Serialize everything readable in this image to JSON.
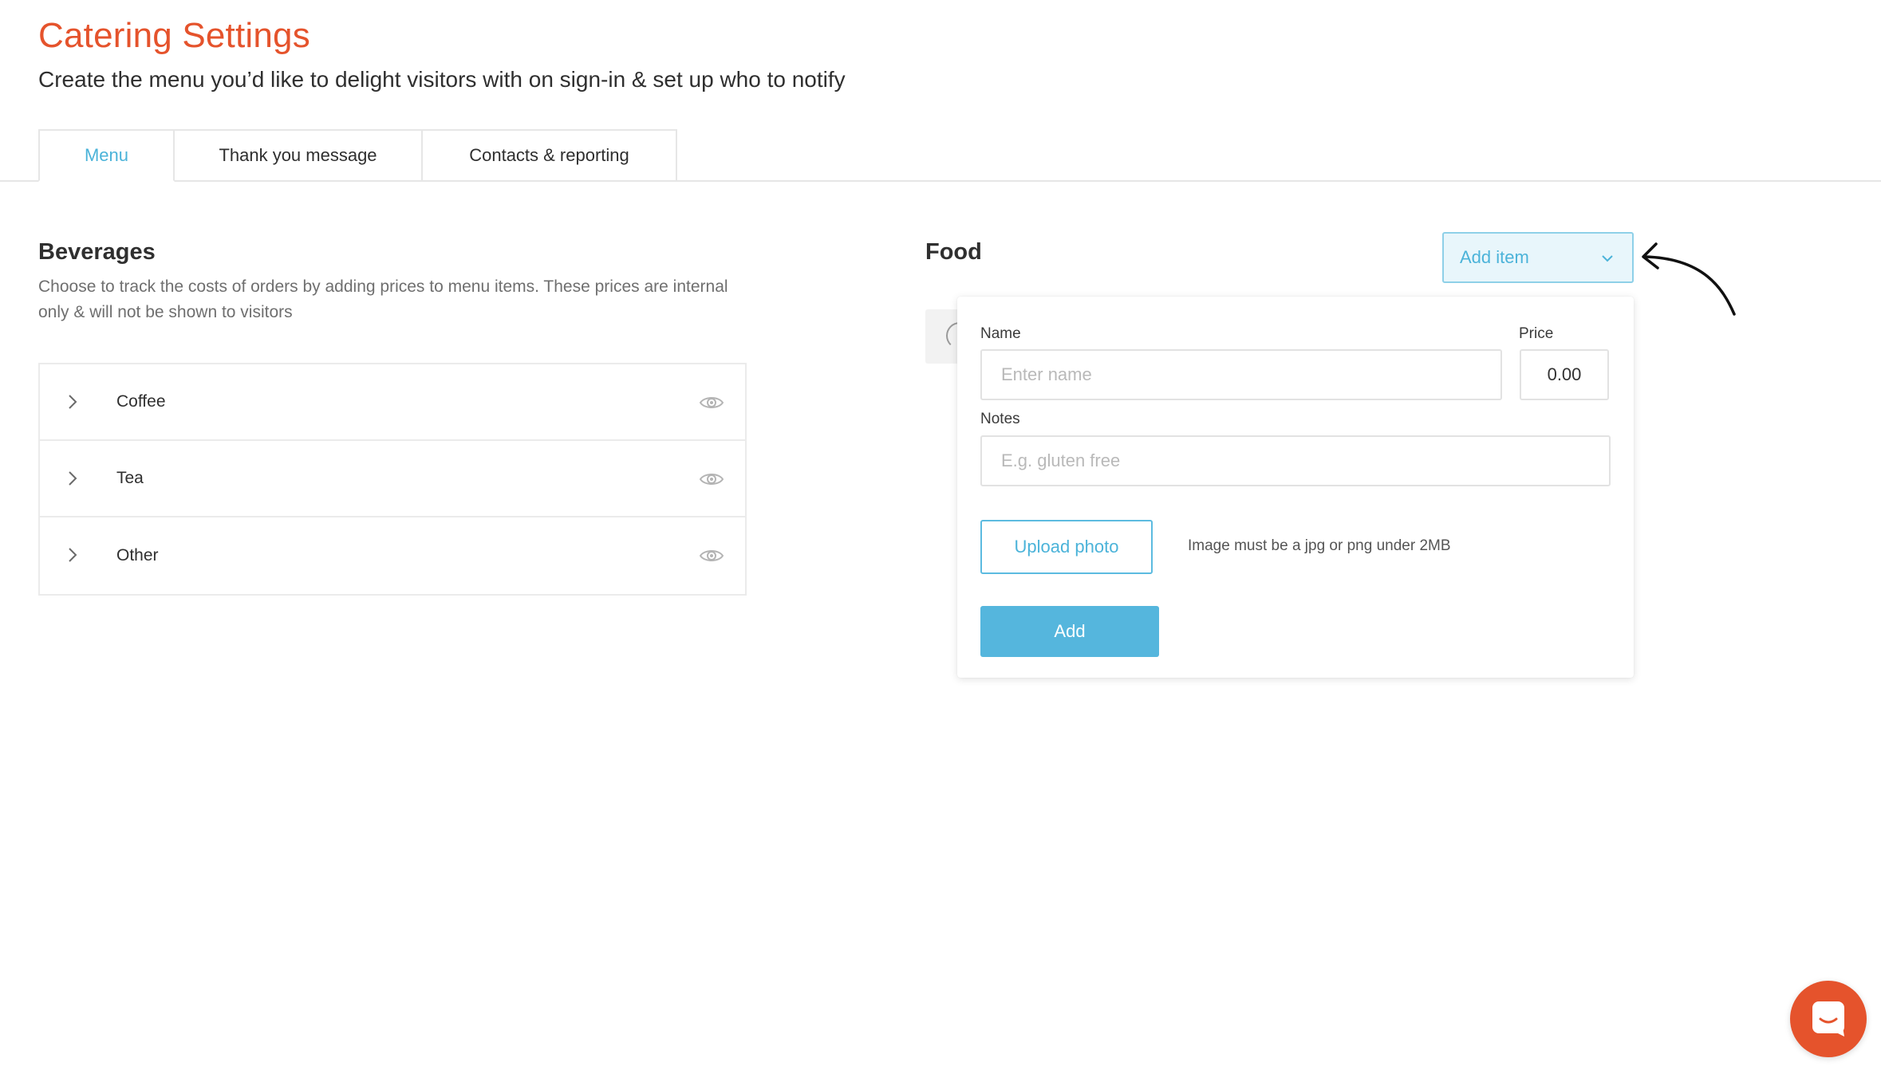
{
  "header": {
    "title": "Catering Settings",
    "subtitle": "Create the menu you’d like to delight visitors with on sign-in & set up who to notify"
  },
  "tabs": [
    {
      "label": "Menu",
      "active": true
    },
    {
      "label": "Thank you message",
      "active": false
    },
    {
      "label": "Contacts & reporting",
      "active": false
    }
  ],
  "beverages": {
    "heading": "Beverages",
    "description": "Choose to track the costs of orders by adding prices to menu items. These prices are internal only & will not be shown to visitors",
    "items": [
      {
        "label": "Coffee",
        "icon": "eye-icon"
      },
      {
        "label": "Tea",
        "icon": "eye-icon"
      },
      {
        "label": "Other",
        "icon": "eye-icon"
      }
    ]
  },
  "food": {
    "heading": "Food",
    "add_item_label": "Add item"
  },
  "add_item_form": {
    "name_label": "Name",
    "name_placeholder": "Enter name",
    "price_label": "Price",
    "price_value": "0.00",
    "notes_label": "Notes",
    "notes_placeholder": "E.g. gluten free",
    "upload_label": "Upload photo",
    "upload_note": "Image must be a jpg or png under 2MB",
    "submit_label": "Add"
  },
  "colors": {
    "accent_orange": "#e5532c",
    "accent_blue": "#4bb3d9",
    "add_button_blue": "#55b6dd"
  }
}
